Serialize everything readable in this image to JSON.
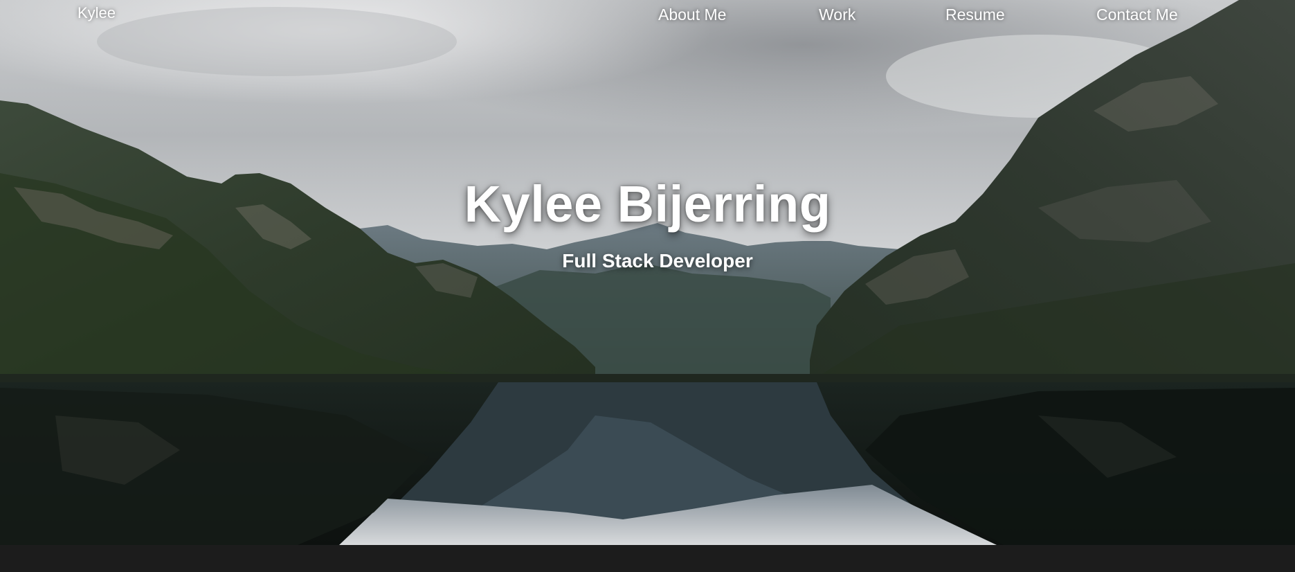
{
  "site": {
    "brand": "Kylee"
  },
  "nav": {
    "items": [
      {
        "label": "About Me"
      },
      {
        "label": "Work"
      },
      {
        "label": "Resume"
      },
      {
        "label": "Contact Me"
      }
    ]
  },
  "hero": {
    "title": "Kylee Bijerring",
    "subtitle": "Full Stack Developer",
    "image": "fjord-landscape-photo"
  },
  "colors": {
    "text": "#ffffff",
    "footer": "#1c1c1c"
  }
}
